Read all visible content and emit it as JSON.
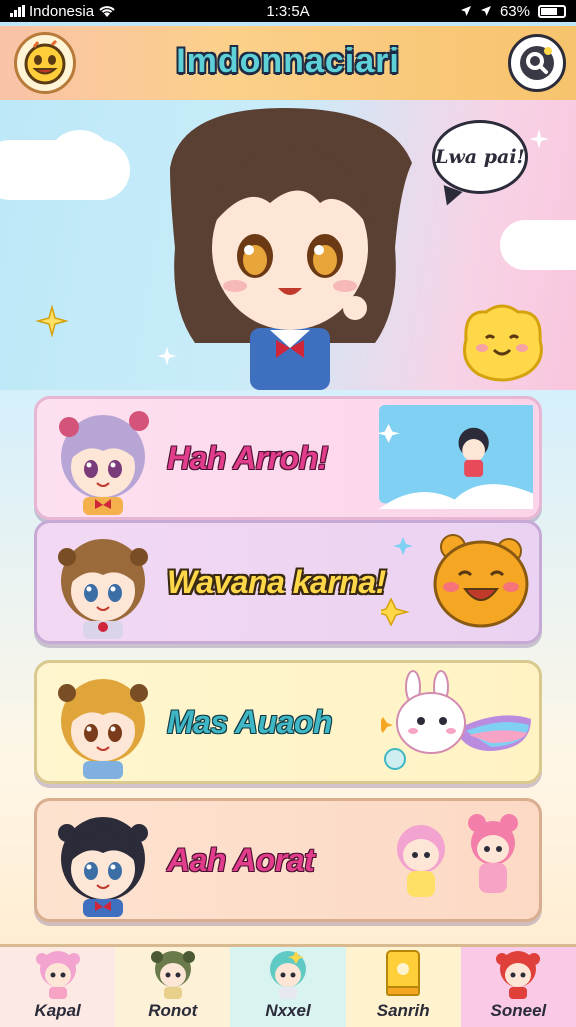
{
  "status_bar": {
    "carrier": "Indonesia",
    "time": "1:3:5A",
    "battery": "63%"
  },
  "header": {
    "title": "Imdonnaciari",
    "logo_icon": "smiley-face-icon",
    "search_icon": "search-icon"
  },
  "hero": {
    "speech_bubble": "Lwa pai!"
  },
  "cards": [
    {
      "label": "Hah Arroh!",
      "color": "#e23d8c"
    },
    {
      "label": "Wavana karna!",
      "color": "#ffd84a"
    },
    {
      "label": "Mas Auaoh",
      "color": "#3fb7c4"
    },
    {
      "label": "Aah Aorat",
      "color": "#e23d8c"
    }
  ],
  "bottom_nav": [
    {
      "label": "Kapal",
      "icon": "pink-hair-chibi-icon"
    },
    {
      "label": "Ronot",
      "icon": "green-hair-chibi-icon"
    },
    {
      "label": "Nxxel",
      "icon": "teal-hair-chibi-icon"
    },
    {
      "label": "Sanrih",
      "icon": "book-icon"
    },
    {
      "label": "Soneel",
      "icon": "red-hair-chibi-icon"
    }
  ],
  "colors": {
    "header_bg": "#fbd08a",
    "title": "#5ed0d8",
    "accent_pink": "#e23d8c"
  }
}
